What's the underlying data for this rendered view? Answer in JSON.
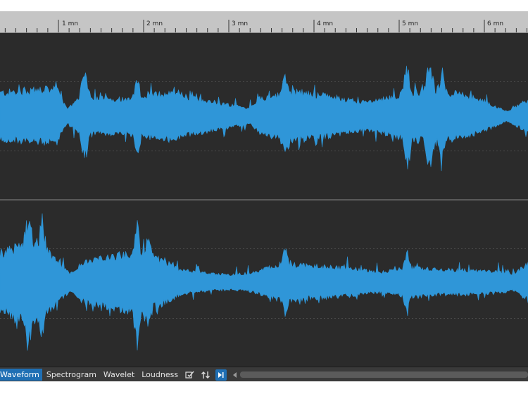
{
  "timeline": {
    "tick_labels": [
      "1 mn",
      "2 mn",
      "3 mn",
      "4 mn",
      "5 mn",
      "6 mn"
    ]
  },
  "waveform": {
    "channels": [
      "channel-1",
      "channel-2"
    ],
    "wave_color": "#2f96d8",
    "background_color": "#2b2b2b"
  },
  "bottom_bar": {
    "tabs": [
      "Waveform",
      "Spectrogram",
      "Wavelet",
      "Loudness"
    ],
    "active_tab": "Waveform",
    "accent_color": "#1f6fb4"
  }
}
